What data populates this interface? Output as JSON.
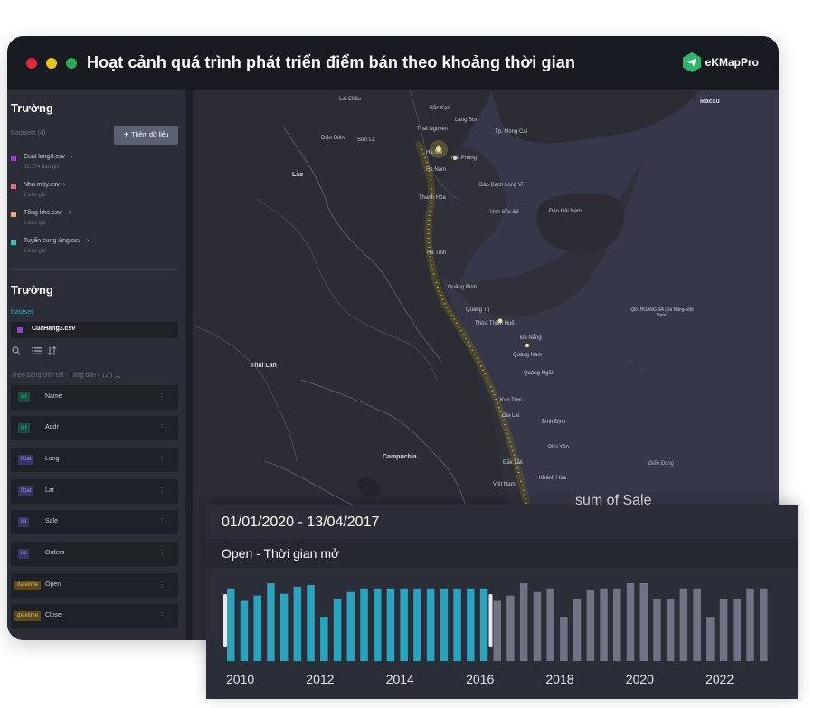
{
  "window": {
    "title": "Hoạt cảnh quá trình phát triển điểm bán theo khoảng thời gian",
    "brand": "eKMapPro",
    "colors": {
      "accent": "#2ba3bf",
      "inactive_bar": "#6f7383",
      "brand_green": "#2fb56a"
    }
  },
  "sidebar": {
    "section1_title": "Trường",
    "datasets_label": "Datasets (4)",
    "add_button": "Thêm dữ liệu",
    "datasets": [
      {
        "name": "CuaHang3.csv",
        "count": "32,774 bản ghi",
        "color": "#a23bd6"
      },
      {
        "name": "Nhà máy.csv",
        "count": "2 bản ghi",
        "color": "#e0708a"
      },
      {
        "name": "Tổng kho.csv",
        "count": "9 bản ghi",
        "color": "#f2a77a"
      },
      {
        "name": "Tuyển cung ứng.csv",
        "count": "9 bản ghi",
        "color": "#2fc4c0"
      }
    ],
    "section2_title": "Trường",
    "dataset_label": "Dataset",
    "selected_dataset": "CuaHang3.csv",
    "sort_label": "Theo bảng chữ cái - Tăng dần ( 12 )",
    "fields": [
      {
        "type": "str",
        "name": "Name"
      },
      {
        "type": "str",
        "name": "Addr"
      },
      {
        "type": "float",
        "name": "Long"
      },
      {
        "type": "float",
        "name": "Lat"
      },
      {
        "type": "int",
        "name": "Sale"
      },
      {
        "type": "int",
        "name": "Orders"
      },
      {
        "type": "datetime",
        "name": "Open"
      },
      {
        "type": "datetime",
        "name": "Close"
      }
    ]
  },
  "map": {
    "labels": {
      "lai_chau": "Lai Châu",
      "bac_kan": "Bắc Kạn",
      "lang_son": "Lạng Sơn",
      "dien_bien": "Điện Biên",
      "son_la": "Sơn La",
      "thai_nguyen": "Thái Nguyên",
      "tp_mong_cai": "Tp. Móng Cái",
      "ha_noi": "Hà Nội",
      "hai_phong": "Hải Phòng",
      "ha_nam": "Hà Nam",
      "thanh_hoa": "Thanh Hóa",
      "dao_bach_long_vi": "Đảo Bạch Long Vĩ",
      "vinh_bac_bo": "Vịnh Bắc Bộ",
      "dao_hai_nam": "Đảo Hải Nam",
      "macau": "Macau",
      "lao": "Lào",
      "ha_tinh": "Hà Tĩnh",
      "quang_binh": "Quảng Bình",
      "quang_tri": "Quảng Trị",
      "thua_thien_hue": "Thừa Thiên Huế",
      "hoang_sa": "QĐ. HOÀNG SA (Đà Nẵng-Việt Nam)",
      "da_nang": "Đà Nẵng",
      "quang_nam": "Quảng Nam",
      "quang_ngai": "Quảng Ngãi",
      "thai_lan": "Thái Lan",
      "kon_tum": "Kon Tum",
      "gia_lai": "Gia Lai",
      "binh_dinh": "Bình Định",
      "phu_yen": "Phú Yên",
      "campuchia": "Campuchia",
      "dak_lak": "Đắk Lắk",
      "bien_dong": "Biển Đông",
      "khanh_hoa": "Khánh Hòa",
      "viet_nam": "Việt Nam"
    },
    "overlay_label": "sum of Sale"
  },
  "timeline": {
    "range": "01/01/2020 - 13/04/2017",
    "field": "Open - Thời gian mở"
  },
  "chart_data": {
    "type": "bar",
    "x_tick_labels": [
      "2010",
      "2012",
      "2014",
      "2016",
      "2018",
      "2020",
      "2022"
    ],
    "values": [
      82,
      68,
      74,
      88,
      76,
      84,
      86,
      50,
      70,
      78,
      82,
      82,
      82,
      82,
      82,
      82,
      82,
      82,
      82,
      82,
      68,
      74,
      88,
      78,
      82,
      50,
      70,
      80,
      82,
      82,
      88,
      88,
      70,
      70,
      82,
      82,
      50,
      70,
      70,
      82,
      82
    ],
    "selected_count": 20,
    "selected_color": "#2ba3bf",
    "unselected_color": "#6f7383"
  }
}
